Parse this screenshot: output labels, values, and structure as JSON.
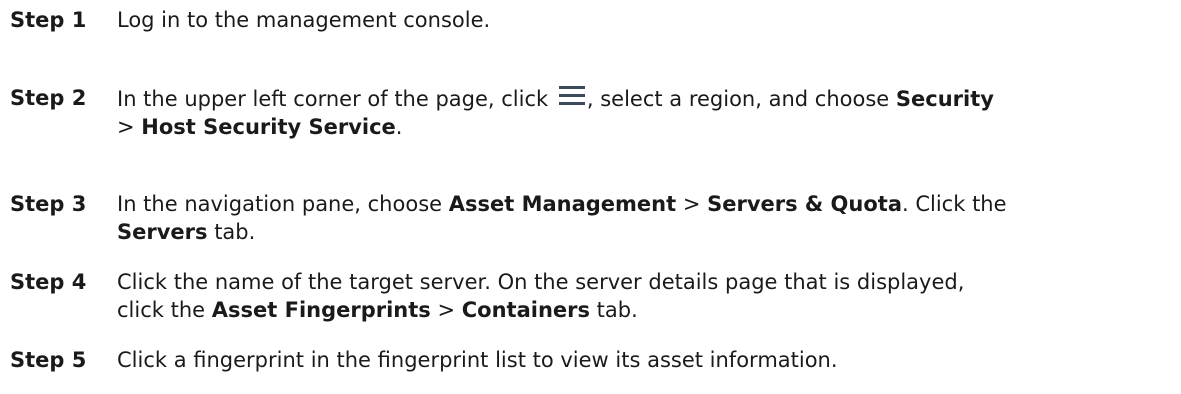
{
  "steps": [
    {
      "label": "Step 1",
      "segments": [
        "Log in to the management console."
      ]
    },
    {
      "label": "Step 2",
      "segments": [
        "In the upper left corner of the page, click ",
        ", select a region, and choose ",
        "Security",
        "> ",
        "Host Security Service",
        "."
      ]
    },
    {
      "label": "Step 3",
      "segments": [
        "In the navigation pane, choose ",
        "Asset Management",
        " > ",
        "Servers & Quota",
        ". Click the",
        "Servers",
        " tab."
      ]
    },
    {
      "label": "Step 4",
      "segments": [
        "Click the name of the target server. On the server details page that is displayed,",
        "click the ",
        "Asset Fingerprints",
        " > ",
        "Containers",
        " tab."
      ]
    },
    {
      "label": "Step 5",
      "segments": [
        "Click a fingerprint in the fingerprint list to view its asset information."
      ]
    }
  ],
  "icons": {
    "menu": "menu-icon",
    "menu_color": "#3d4a5c"
  }
}
